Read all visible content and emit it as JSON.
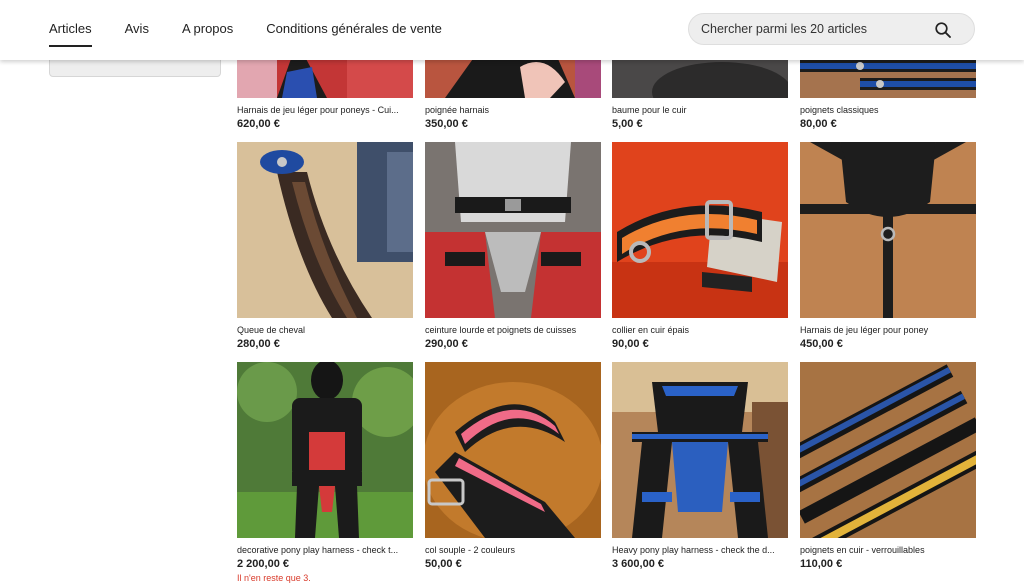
{
  "nav": {
    "tabs": [
      {
        "label": "Articles",
        "active": true
      },
      {
        "label": "Avis",
        "active": false
      },
      {
        "label": "A propos",
        "active": false
      },
      {
        "label": "Conditions générales de vente",
        "active": false
      }
    ],
    "search_placeholder": "Chercher parmi les 20 articles",
    "search_icon": "search-icon"
  },
  "listings": [
    {
      "title": "Harnais de jeu léger pour poneys - Cui...",
      "price": "620,00 €"
    },
    {
      "title": "poignée harnais",
      "price": "350,00 €"
    },
    {
      "title": "baume pour le cuir",
      "price": "5,00 €"
    },
    {
      "title": "poignets classiques",
      "price": "80,00 €"
    },
    {
      "title": "Queue de cheval",
      "price": "280,00 €"
    },
    {
      "title": "ceinture lourde et poignets de cuisses",
      "price": "290,00 €"
    },
    {
      "title": "collier en cuir épais",
      "price": "90,00 €"
    },
    {
      "title": "Harnais de jeu léger pour poney",
      "price": "450,00 €"
    },
    {
      "title": "decorative pony play harness - check t...",
      "price": "2 200,00 €",
      "stock_note": "Il n'en reste que 3."
    },
    {
      "title": "col souple - 2 couleurs",
      "price": "50,00 €"
    },
    {
      "title": "Heavy pony play harness - check the d...",
      "price": "3 600,00 €"
    },
    {
      "title": "poignets en cuir - verrouillables",
      "price": "110,00 €"
    }
  ],
  "colors": {
    "accent": "#222222",
    "stock_warning": "#d93b2b",
    "search_bg": "#eeeeee"
  }
}
